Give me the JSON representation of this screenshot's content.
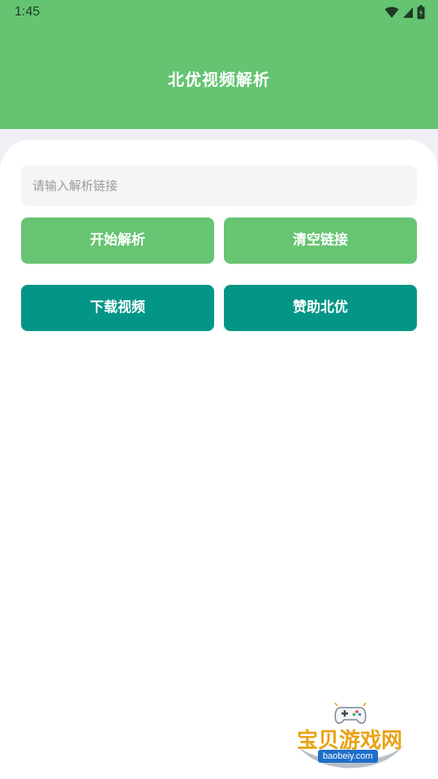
{
  "status_bar": {
    "time": "1:45",
    "icons": [
      "wifi-icon",
      "signal-icon",
      "battery-icon"
    ]
  },
  "header": {
    "title": "北优视频解析"
  },
  "form": {
    "url_placeholder": "请输入解析链接",
    "url_value": ""
  },
  "buttons": {
    "parse": "开始解析",
    "clear": "清空链接",
    "download": "下载视频",
    "sponsor": "赞助北优"
  },
  "watermark": {
    "brand": "宝贝游戏网",
    "url": "baobeiy.com",
    "icon": "gamepad-icon"
  },
  "colors": {
    "header_green": "#64c472",
    "button_green": "#66c472",
    "button_teal": "#039686",
    "watermark_orange": "#e8a317",
    "watermark_blue": "#1f6fc9"
  }
}
